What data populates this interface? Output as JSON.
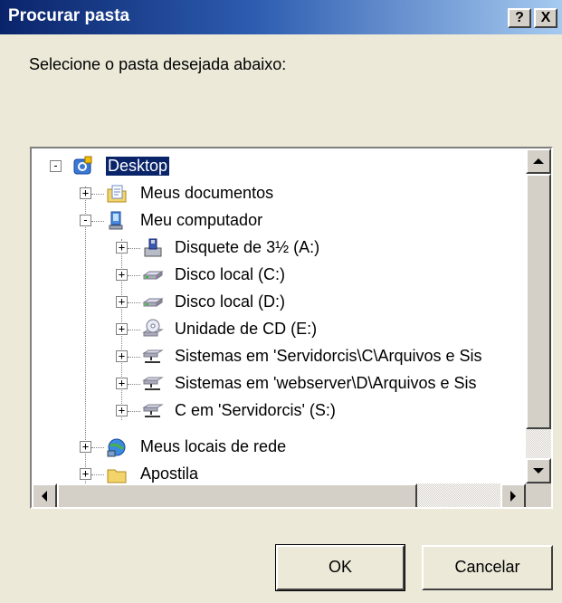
{
  "window": {
    "title": "Procurar pasta",
    "help_label": "?",
    "close_label": "X"
  },
  "instruction": "Selecione o pasta desejada abaixo:",
  "tree": {
    "items": [
      {
        "label": "Desktop",
        "expander": "-",
        "icon": "desktop-icon",
        "selected": true
      },
      {
        "label": "Meus documentos",
        "expander": "+",
        "icon": "folder-documents-icon"
      },
      {
        "label": "Meu computador",
        "expander": "-",
        "icon": "computer-icon"
      },
      {
        "label": "Disquete de 3½ (A:)",
        "expander": "+",
        "icon": "floppy-drive-icon"
      },
      {
        "label": "Disco local (C:)",
        "expander": "+",
        "icon": "hard-drive-icon"
      },
      {
        "label": "Disco local (D:)",
        "expander": "+",
        "icon": "hard-drive-icon"
      },
      {
        "label": "Unidade de CD (E:)",
        "expander": "+",
        "icon": "cd-drive-icon"
      },
      {
        "label": "Sistemas em 'Servidorcis\\C\\Arquivos e Sis",
        "expander": "+",
        "icon": "network-drive-icon"
      },
      {
        "label": "Sistemas em 'webserver\\D\\Arquivos e Sis",
        "expander": "+",
        "icon": "network-drive-icon"
      },
      {
        "label": "C em 'Servidorcis' (S:)",
        "expander": "+",
        "icon": "network-drive-icon"
      },
      {
        "label": "Meus locais de rede",
        "expander": "+",
        "icon": "network-places-icon"
      },
      {
        "label": "Apostila",
        "expander": "+",
        "icon": "folder-icon"
      }
    ]
  },
  "buttons": {
    "ok": "OK",
    "cancel": "Cancelar"
  },
  "colors": {
    "titlebar_start": "#0a246a",
    "titlebar_end": "#a6caf0",
    "selection": "#0a246a",
    "dialog_bg": "#ece9d8"
  }
}
